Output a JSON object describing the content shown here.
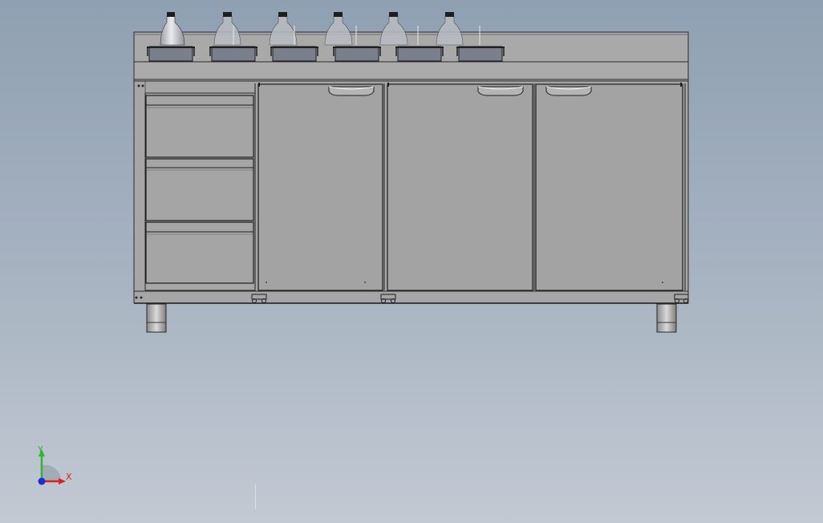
{
  "viewport": {
    "background_top": "#8fa0b2",
    "background_bottom": "#c2c9d3"
  },
  "model": {
    "body_color": "#a7a7a7",
    "door_color": "#a3a3a3",
    "edge_color": "#2a2a2a",
    "basket_color": "#7a7f8c",
    "bottle_color": "#c4c7cc",
    "bottle_cap_color": "#1e1e1e",
    "leg_color": "#bdbdbd",
    "bottle_count": 6,
    "basket_count": 6,
    "drawer_count": 3,
    "door_count": 3,
    "leg_count": 2
  },
  "triad": {
    "x_label": "X",
    "y_label": "Y",
    "x_color": "#e0201b",
    "y_color": "#2fb52f",
    "z_color": "#1b2fd6"
  }
}
